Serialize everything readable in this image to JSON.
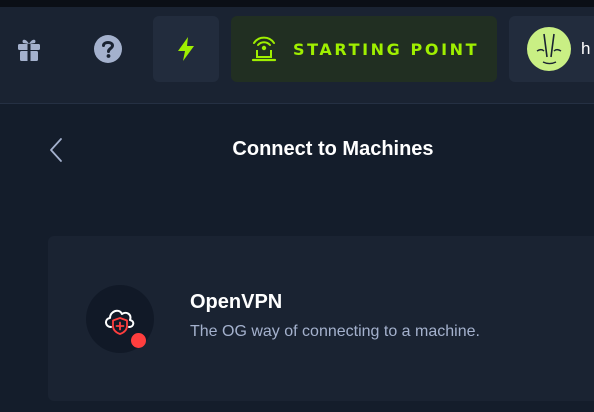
{
  "topbar": {
    "gift": {
      "icon": "gift-icon"
    },
    "help": {
      "icon": "question-icon"
    },
    "quick_action": {
      "icon": "lightning-icon"
    },
    "starting_point": {
      "label": "STARTING POINT",
      "icon": "starting-point-icon"
    },
    "user": {
      "username_visible": "h",
      "avatar_icon": "avatar-icon"
    }
  },
  "page": {
    "back_icon": "chevron-left-icon",
    "title": "Connect to Machines"
  },
  "option": {
    "title": "OpenVPN",
    "description": "The OG way of connecting to a machine.",
    "icon": "cloud-shield-icon",
    "status": "disconnected"
  },
  "colors": {
    "background": "#141d2b",
    "panel": "#1a2332",
    "accent_green": "#9fef00",
    "status_red": "#ff3e3e",
    "muted_text": "#a4b1cd"
  }
}
